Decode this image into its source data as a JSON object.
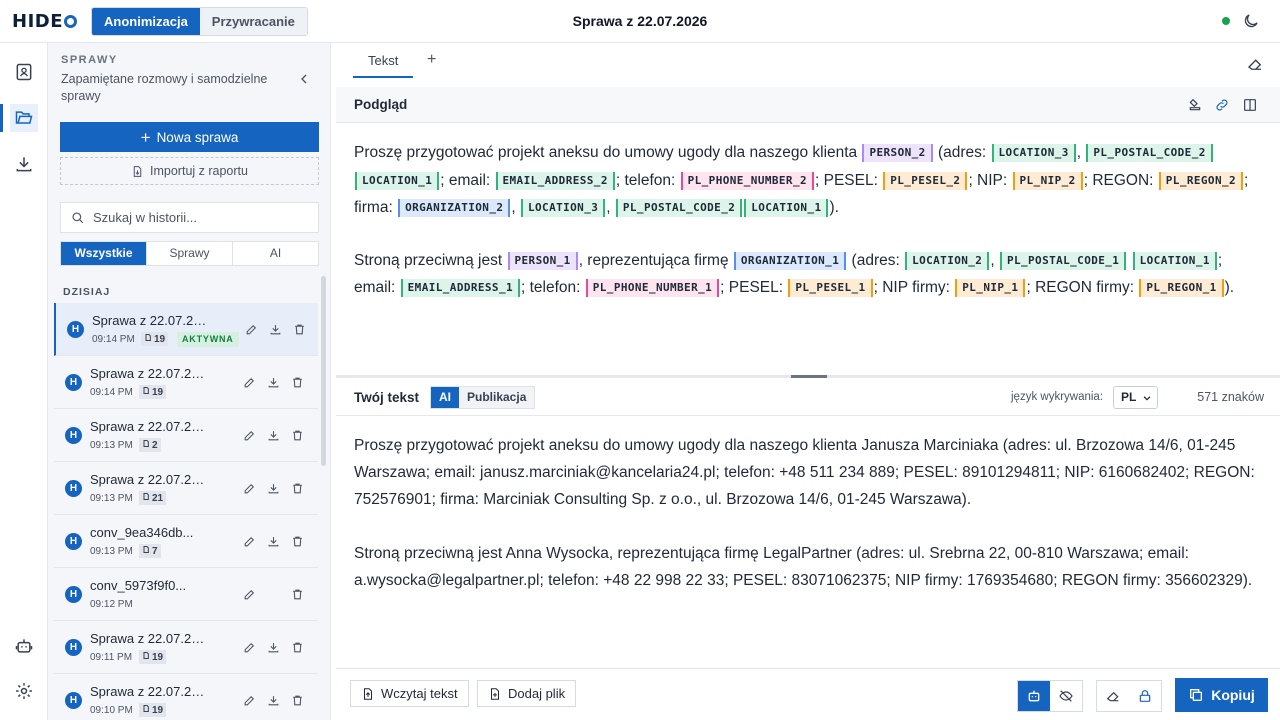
{
  "app": {
    "logo": "HIDE",
    "mode_tabs": [
      "Anonimizacja",
      "Przywracanie"
    ],
    "active_mode": 0,
    "title": "Sprawa z 22.07.2026",
    "status_color": "#16a34a",
    "accent_color": "#1565c0"
  },
  "rail": {
    "icons": [
      "contact-book-icon",
      "folder-open-icon",
      "download-icon",
      "robot-icon",
      "gear-icon"
    ],
    "active": 1
  },
  "sidebar": {
    "label": "SPRAWY",
    "subtitle": "Zapamiętane rozmowy i samodzielne sprawy",
    "new_case": "Nowa sprawa",
    "import": "Importuj z raportu",
    "search_placeholder": "Szukaj w historii...",
    "filters": [
      "Wszystkie",
      "Sprawy",
      "AI"
    ],
    "active_filter": 0,
    "group": "DZISIAJ",
    "items": [
      {
        "title": "Sprawa z 22.07.2026",
        "time": "09:14 PM",
        "count": "19",
        "badge": "AKTYWNA",
        "active": true,
        "edit": true,
        "download": true
      },
      {
        "title": "Sprawa z 22.07.2026",
        "time": "09:14 PM",
        "count": "19",
        "badge": "",
        "active": false,
        "edit": true,
        "download": true
      },
      {
        "title": "Sprawa z 22.07.2026",
        "time": "09:13 PM",
        "count": "2",
        "badge": "",
        "active": false,
        "edit": true,
        "download": true
      },
      {
        "title": "Sprawa z 22.07.2026",
        "time": "09:13 PM",
        "count": "21",
        "badge": "",
        "active": false,
        "edit": true,
        "download": true
      },
      {
        "title": "conv_9ea346db...",
        "time": "09:13 PM",
        "count": "7",
        "badge": "",
        "active": false,
        "edit": true,
        "download": true
      },
      {
        "title": "conv_5973f9f0...",
        "time": "09:12 PM",
        "count": "",
        "badge": "",
        "active": false,
        "edit": true,
        "download": false
      },
      {
        "title": "Sprawa z 22.07.2026",
        "time": "09:11 PM",
        "count": "19",
        "badge": "",
        "active": false,
        "edit": true,
        "download": true
      },
      {
        "title": "Sprawa z 22.07.2026",
        "time": "09:10 PM",
        "count": "19",
        "badge": "",
        "active": false,
        "edit": true,
        "download": true
      }
    ]
  },
  "main": {
    "tab": "Tekst",
    "tab_add": "+",
    "preview_label": "Podgląd",
    "preview": [
      [
        {
          "t": "Proszę przygotować projekt aneksu do umowy ugody dla naszego klienta "
        },
        {
          "k": "PERSON_2",
          "c": "person"
        },
        {
          "t": " (adres: "
        },
        {
          "k": "LOCATION_3",
          "c": "loc"
        },
        {
          "t": ", "
        },
        {
          "k": "PL_POSTAL_CODE_2",
          "c": "loc"
        },
        {
          "k": "LOCATION_1",
          "c": "loc"
        },
        {
          "t": "; email: "
        },
        {
          "k": "EMAIL_ADDRESS_2",
          "c": "email"
        },
        {
          "t": "; telefon: "
        },
        {
          "k": "PL_PHONE_NUMBER_2",
          "c": "phone"
        },
        {
          "t": "; PESEL: "
        },
        {
          "k": "PL_PESEL_2",
          "c": "pesel"
        },
        {
          "t": "; NIP: "
        },
        {
          "k": "PL_NIP_2",
          "c": "pesel"
        },
        {
          "t": "; REGON: "
        },
        {
          "k": "PL_REGON_2",
          "c": "pesel"
        },
        {
          "t": "; firma: "
        },
        {
          "k": "ORGANIZATION_2",
          "c": "org"
        },
        {
          "t": ", "
        },
        {
          "k": "LOCATION_3",
          "c": "loc"
        },
        {
          "t": ", "
        },
        {
          "k": "PL_POSTAL_CODE_2",
          "c": "loc"
        },
        {
          "k": "LOCATION_1",
          "c": "loc"
        },
        {
          "t": ")."
        }
      ],
      [
        {
          "t": "Stroną przeciwną jest "
        },
        {
          "k": "PERSON_1",
          "c": "person"
        },
        {
          "t": ", reprezentująca firmę "
        },
        {
          "k": "ORGANIZATION_1",
          "c": "org"
        },
        {
          "t": " (adres: "
        },
        {
          "k": "LOCATION_2",
          "c": "loc"
        },
        {
          "t": ", "
        },
        {
          "k": "PL_POSTAL_CODE_1",
          "c": "loc"
        },
        {
          "t": " "
        },
        {
          "k": "LOCATION_1",
          "c": "loc"
        },
        {
          "t": "; email: "
        },
        {
          "k": "EMAIL_ADDRESS_1",
          "c": "email"
        },
        {
          "t": "; telefon: "
        },
        {
          "k": "PL_PHONE_NUMBER_1",
          "c": "phone"
        },
        {
          "t": "; PESEL: "
        },
        {
          "k": "PL_PESEL_1",
          "c": "pesel"
        },
        {
          "t": "; NIP firmy: "
        },
        {
          "k": "PL_NIP_1",
          "c": "pesel"
        },
        {
          "t": "; REGON firmy: "
        },
        {
          "k": "PL_REGON_1",
          "c": "pesel"
        },
        {
          "t": ")."
        }
      ]
    ],
    "your_text_label": "Twój tekst",
    "segments": [
      "AI",
      "Publikacja"
    ],
    "active_segment": 0,
    "lang_label": "język wykrywania:",
    "lang_value": "PL",
    "char_count": "571 znaków",
    "your_text": [
      "Proszę przygotować projekt aneksu do umowy ugody dla naszego klienta Janusza Marciniaka (adres: ul. Brzozowa 14/6, 01-245 Warszawa; email: janusz.marciniak@kancelaria24.pl; telefon: +48 511 234 889; PESEL: 89101294811; NIP: 6160682402; REGON: 752576901; firma: Marciniak Consulting Sp. z o.o., ul. Brzozowa 14/6, 01-245 Warszawa).",
      "Stroną przeciwną jest Anna Wysocka, reprezentująca firmę LegalPartner (adres: ul. Srebrna 22, 00-810 Warszawa; email: a.wysocka@legalpartner.pl; telefon: +48 22 998 22 33; PESEL: 83071062375; NIP firmy: 1769354680; REGON firmy: 356602329)."
    ],
    "load_text": "Wczytaj tekst",
    "add_file": "Dodaj plik",
    "copy": "Kopiuj"
  }
}
